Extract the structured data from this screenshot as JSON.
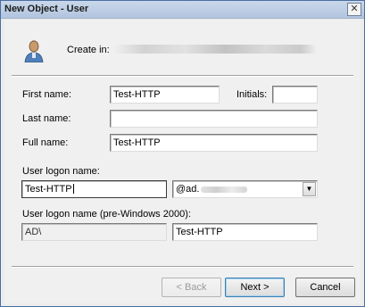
{
  "window": {
    "title": "New Object - User",
    "close_glyph": "✕"
  },
  "header": {
    "create_in_label": "Create in:",
    "create_in_value": ""
  },
  "form": {
    "first_name_label": "First name:",
    "first_name_value": "Test-HTTP",
    "initials_label": "Initials:",
    "initials_value": "",
    "last_name_label": "Last name:",
    "last_name_value": "",
    "full_name_label": "Full name:",
    "full_name_value": "Test-HTTP",
    "logon_label": "User logon name:",
    "logon_value": "Test-HTTP",
    "upn_suffix_value": "@ad.",
    "pre2000_label": "User logon name (pre-Windows 2000):",
    "pre2000_domain_value": "AD\\",
    "pre2000_user_value": "Test-HTTP"
  },
  "buttons": {
    "back": "< Back",
    "next": "Next >",
    "cancel": "Cancel"
  },
  "icons": {
    "header_icon": "user-icon",
    "dropdown_icon": "chevron-down-icon"
  }
}
